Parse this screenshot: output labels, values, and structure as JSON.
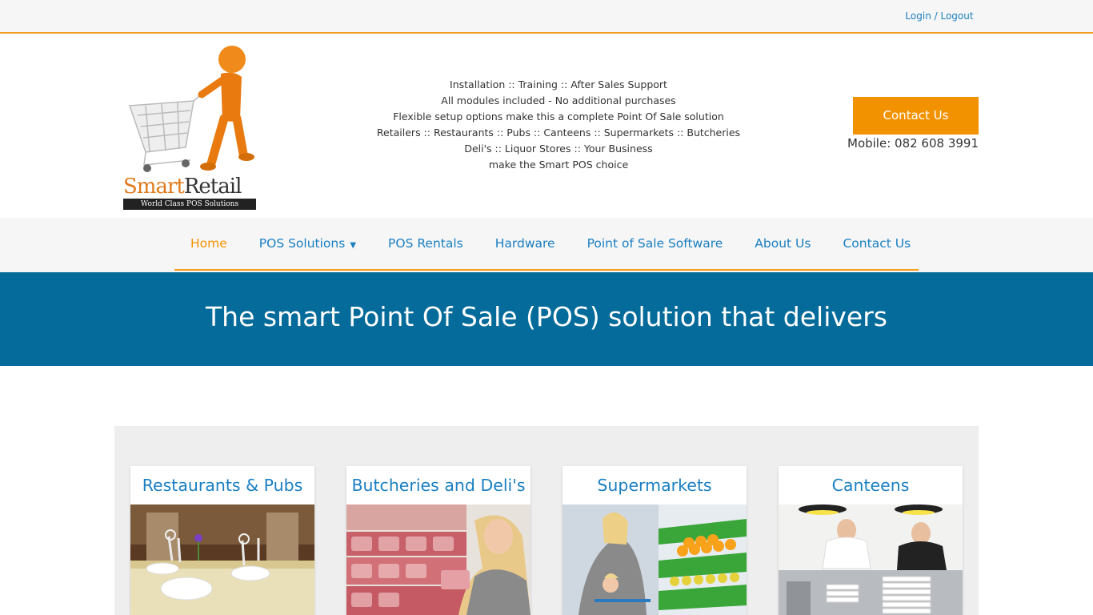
{
  "topbar": {
    "login_label": "Login / Logout"
  },
  "logo": {
    "smart": "Smart",
    "retail": "Retail",
    "tagline": "World Class POS Solutions"
  },
  "header": {
    "tagline_lines": [
      "Installation :: Training :: After Sales Support",
      "All modules included - No additional purchases",
      "Flexible setup options make this a complete Point Of Sale solution",
      "Retailers :: Restaurants :: Pubs :: Canteens :: Supermarkets :: Butcheries",
      "Deli's :: Liquor Stores :: Your Business",
      "make the Smart POS choice"
    ],
    "contact_button": "Contact Us",
    "mobile": "Mobile: 082 608 3991"
  },
  "nav": {
    "items": [
      {
        "label": "Home"
      },
      {
        "label": "POS Solutions"
      },
      {
        "label": "POS Rentals"
      },
      {
        "label": "Hardware"
      },
      {
        "label": "Point of Sale Software"
      },
      {
        "label": "About Us"
      },
      {
        "label": "Contact Us"
      }
    ],
    "dropdown_icon": "chevron-down-icon"
  },
  "hero": {
    "title": "The smart Point Of Sale (POS) solution that delivers"
  },
  "cards": [
    {
      "title": "Restaurants & Pubs"
    },
    {
      "title": "Butcheries and Deli's"
    },
    {
      "title": "Supermarkets"
    },
    {
      "title": "Canteens"
    }
  ],
  "colors": {
    "accent": "#f39200",
    "link": "#1a7fc1",
    "hero_bg": "#046b9a"
  }
}
